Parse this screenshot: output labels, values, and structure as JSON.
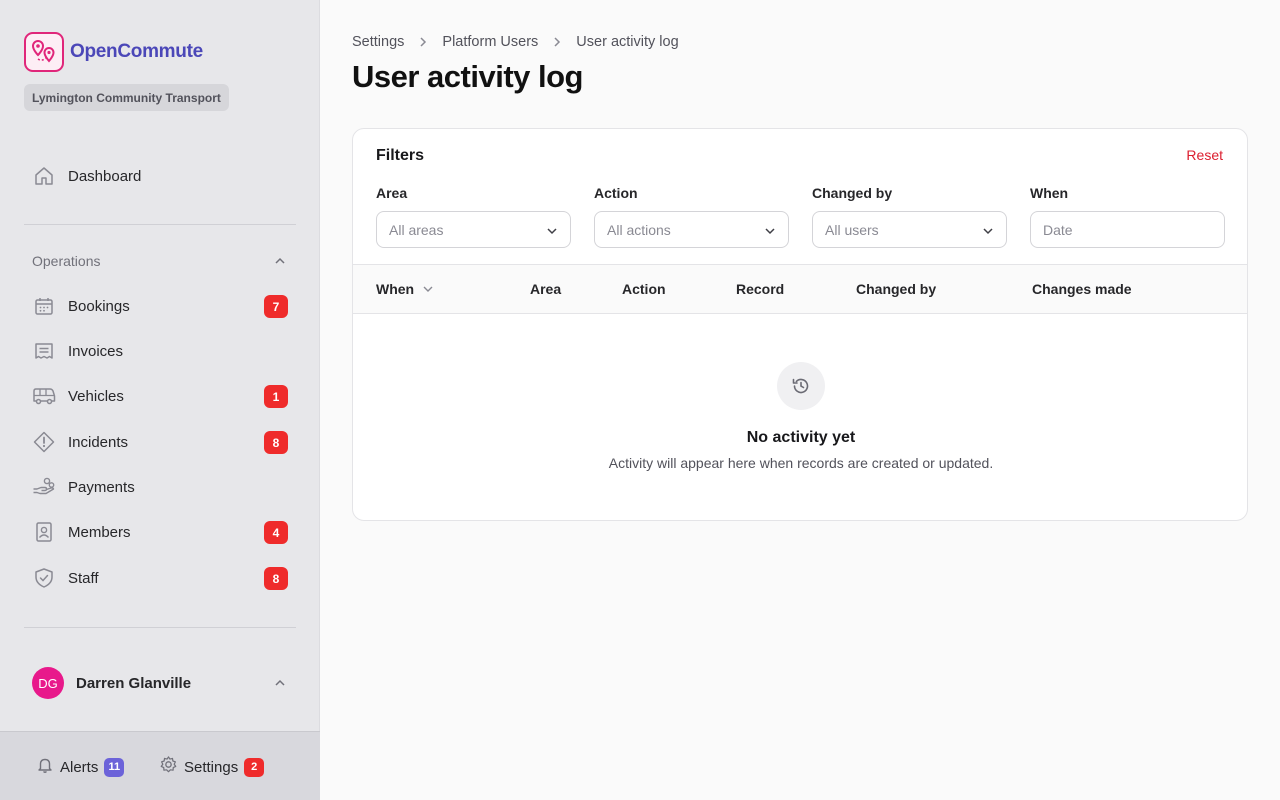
{
  "brand": {
    "name": "OpenCommute",
    "org": "Lymington Community Transport",
    "accent": "#4b47b8",
    "logo_color": "#e0267a"
  },
  "sidebar": {
    "dashboard": {
      "label": "Dashboard",
      "icon": "home-icon"
    },
    "section": {
      "label": "Operations"
    },
    "items": [
      {
        "label": "Bookings",
        "icon": "calendar-icon",
        "count": "7"
      },
      {
        "label": "Invoices",
        "icon": "receipt-icon",
        "count": ""
      },
      {
        "label": "Vehicles",
        "icon": "bus-icon",
        "count": "1"
      },
      {
        "label": "Incidents",
        "icon": "warning-icon",
        "count": "8"
      },
      {
        "label": "Payments",
        "icon": "hand-coins-icon",
        "count": ""
      },
      {
        "label": "Members",
        "icon": "member-card-icon",
        "count": "4"
      },
      {
        "label": "Staff",
        "icon": "shield-check-icon",
        "count": "8"
      }
    ],
    "user": {
      "initials": "DG",
      "name": "Darren Glanville",
      "avatar_color": "#e8198b"
    },
    "footer": {
      "alerts": {
        "label": "Alerts",
        "count": "11",
        "color": "#6c63d9"
      },
      "settings": {
        "label": "Settings",
        "count": "2",
        "color": "#ef2b2b"
      }
    }
  },
  "breadcrumb": [
    "Settings",
    "Platform Users",
    "User activity log"
  ],
  "page": {
    "title": "User activity log"
  },
  "filters": {
    "title": "Filters",
    "reset": "Reset",
    "fields": [
      {
        "label": "Area",
        "placeholder": "All areas",
        "kind": "select"
      },
      {
        "label": "Action",
        "placeholder": "All actions",
        "kind": "select"
      },
      {
        "label": "Changed by",
        "placeholder": "All users",
        "kind": "select"
      },
      {
        "label": "When",
        "placeholder": "Date",
        "kind": "date"
      }
    ]
  },
  "table": {
    "columns": [
      "When",
      "Area",
      "Action",
      "Record",
      "Changed by",
      "Changes made"
    ],
    "sort_column": "When",
    "rows": []
  },
  "empty": {
    "icon": "history-icon",
    "title": "No activity yet",
    "text": "Activity will appear here when records are created or updated."
  }
}
